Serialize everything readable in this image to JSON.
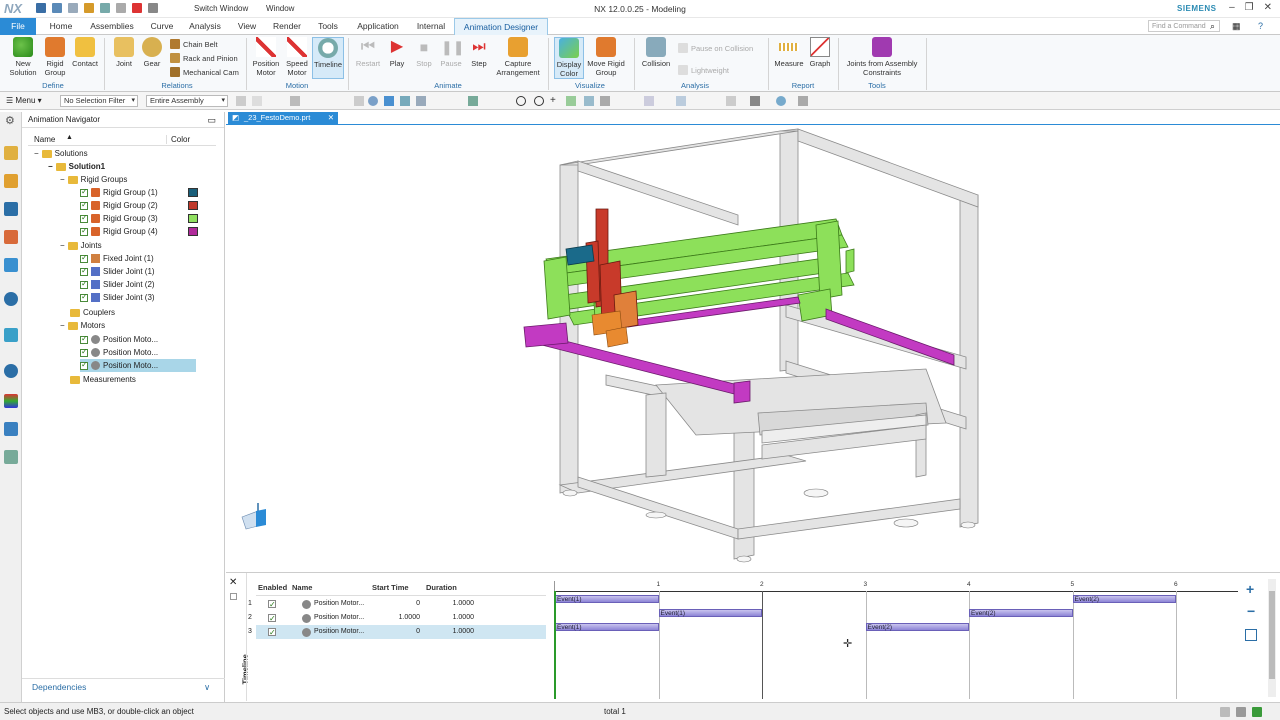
{
  "app": {
    "logo": "NX",
    "title": "NX 12.0.0.25 - Modeling",
    "brand": "SIEMENS",
    "switch_window": "Switch Window",
    "window_menu": "Window"
  },
  "menu": {
    "file": "File",
    "tabs": [
      "Home",
      "Assemblies",
      "Curve",
      "Analysis",
      "View",
      "Render",
      "Tools",
      "Application",
      "Internal",
      "Animation Designer"
    ],
    "find_placeholder": "Find a Command"
  },
  "ribbon": {
    "new_solution": "New Solution",
    "rigid_group": "Rigid Group",
    "contact": "Contact",
    "joint": "Joint",
    "gear": "Gear",
    "chain_belt": "Chain Belt",
    "rack_pinion": "Rack and Pinion",
    "mech_cam": "Mechanical Cam",
    "position_motor": "Position Motor",
    "speed_motor": "Speed Motor",
    "timeline": "Timeline",
    "restart": "Restart",
    "play": "Play",
    "stop": "Stop",
    "pause": "Pause",
    "step": "Step",
    "capture": "Capture Arrangement",
    "display_color": "Display Color",
    "move_rigid": "Move Rigid Group",
    "collision": "Collision",
    "pause_collision": "Pause on Collision",
    "lightweight": "Lightweight",
    "measure": "Measure",
    "graph": "Graph",
    "joints_from_asm": "Joints from Assembly Constraints",
    "groups": {
      "define": "Define",
      "relations": "Relations",
      "motion": "Motion",
      "animate": "Animate",
      "visualize": "Visualize",
      "analysis": "Analysis",
      "report": "Report",
      "tools": "Tools"
    }
  },
  "toolbar2": {
    "menu": "Menu",
    "filter": "No Selection Filter",
    "scope": "Entire Assembly"
  },
  "navigator": {
    "title": "Animation Navigator",
    "col_name": "Name",
    "col_color": "Color",
    "solutions": "Solutions",
    "solution1": "Solution1",
    "rigid_groups": "Rigid Groups",
    "rg": [
      {
        "label": "Rigid Group (1)",
        "color": "#1a5f7a"
      },
      {
        "label": "Rigid Group (2)",
        "color": "#c0392b"
      },
      {
        "label": "Rigid Group (3)",
        "color": "#90e060"
      },
      {
        "label": "Rigid Group (4)",
        "color": "#b02a9a"
      }
    ],
    "joints": "Joints",
    "joint_items": [
      "Fixed Joint (1)",
      "Slider Joint (1)",
      "Slider Joint (2)",
      "Slider Joint (3)"
    ],
    "couplers": "Couplers",
    "motors": "Motors",
    "motor_items": [
      "Position Moto...",
      "Position Moto...",
      "Position Moto..."
    ],
    "measurements": "Measurements",
    "dependencies": "Dependencies"
  },
  "document": {
    "tab": "_23_FestoDemo.prt"
  },
  "timeline": {
    "label": "Timeline",
    "headers": {
      "enabled": "Enabled",
      "name": "Name",
      "start": "Start Time",
      "duration": "Duration"
    },
    "rows": [
      {
        "num": "1",
        "name": "Position Motor...",
        "start": "0",
        "duration": "1.0000"
      },
      {
        "num": "2",
        "name": "Position Motor...",
        "start": "1.0000",
        "duration": "1.0000"
      },
      {
        "num": "3",
        "name": "Position Motor...",
        "start": "0",
        "duration": "1.0000"
      }
    ],
    "ticks": [
      "1",
      "2",
      "3",
      "4",
      "5",
      "6"
    ],
    "events": [
      {
        "row": 0,
        "start": 0,
        "end": 1,
        "label": "Event(1)"
      },
      {
        "row": 0,
        "start": 5,
        "end": 6,
        "label": "Event(2)"
      },
      {
        "row": 1,
        "start": 1,
        "end": 2,
        "label": "Event(1)"
      },
      {
        "row": 1,
        "start": 4,
        "end": 5,
        "label": "Event(2)"
      },
      {
        "row": 2,
        "start": 0,
        "end": 1,
        "label": "Event(1)"
      },
      {
        "row": 2,
        "start": 3,
        "end": 4,
        "label": "Event(2)"
      }
    ]
  },
  "status": {
    "message": "Select objects and use MB3, or double-click an object",
    "total": "total 1"
  }
}
